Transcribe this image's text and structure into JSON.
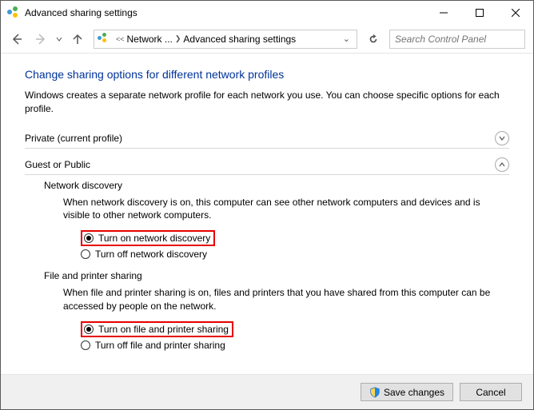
{
  "window": {
    "title": "Advanced sharing settings"
  },
  "breadcrumb": {
    "item1": "Network ...",
    "item2": "Advanced sharing settings"
  },
  "search": {
    "placeholder": "Search Control Panel"
  },
  "heading": "Change sharing options for different network profiles",
  "description": "Windows creates a separate network profile for each network you use. You can choose specific options for each profile.",
  "profiles": {
    "private": {
      "label": "Private (current profile)"
    },
    "guest_public": {
      "label": "Guest or Public"
    }
  },
  "sections": {
    "network_discovery": {
      "title": "Network discovery",
      "desc": "When network discovery is on, this computer can see other network computers and devices and is visible to other network computers.",
      "radio_on": "Turn on network discovery",
      "radio_off": "Turn off network discovery"
    },
    "file_printer": {
      "title": "File and printer sharing",
      "desc": "When file and printer sharing is on, files and printers that you have shared from this computer can be accessed by people on the network.",
      "radio_on": "Turn on file and printer sharing",
      "radio_off": "Turn off file and printer sharing"
    }
  },
  "footer": {
    "save": "Save changes",
    "cancel": "Cancel"
  }
}
